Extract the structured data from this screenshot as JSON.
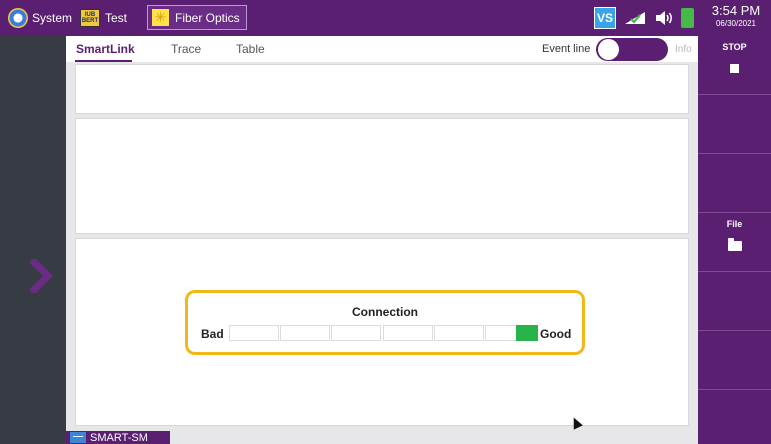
{
  "topbar": {
    "system_label": "System",
    "test_label": "Test",
    "bert_icon_text": "IUB BERT",
    "fiber_label": "Fiber Optics",
    "vs_badge": "VS",
    "time": "3:54 PM",
    "date": "06/30/2021"
  },
  "tabs": [
    {
      "label": "SmartLink",
      "active": true
    },
    {
      "label": "Trace",
      "active": false
    },
    {
      "label": "Table",
      "active": false
    }
  ],
  "event_line": {
    "label": "Event line",
    "state": "off",
    "info_label": "Info"
  },
  "softkeys": {
    "stop_label": "STOP",
    "file_label": "File"
  },
  "connection": {
    "title": "Connection",
    "bad_label": "Bad",
    "good_label": "Good",
    "segments_total": 7,
    "segments_lit": 1,
    "level_color": "#27b34a"
  },
  "bottom_tab": {
    "label": "SMART-SM"
  },
  "colors": {
    "brand": "#5b1f72",
    "highlight": "#f2b81a",
    "left_panel": "#363b44"
  }
}
